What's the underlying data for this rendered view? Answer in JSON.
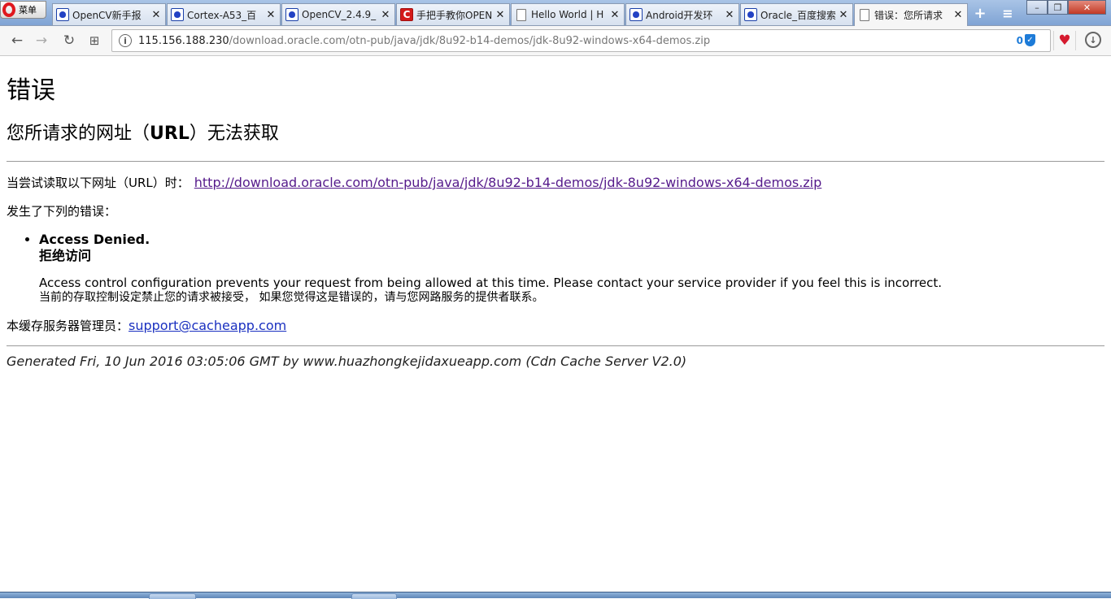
{
  "browser": {
    "menu_label": "菜单",
    "tabs": [
      {
        "title": "OpenCV新手报",
        "icon": "baidu-paw-icon"
      },
      {
        "title": "Cortex-A53_百",
        "icon": "baidu-paw-icon"
      },
      {
        "title": "OpenCV_2.4.9_",
        "icon": "baidu-paw-icon"
      },
      {
        "title": "手把手教你OPEN",
        "icon": "csdn-icon"
      },
      {
        "title": "Hello World | H",
        "icon": "document-icon"
      },
      {
        "title": "Android开发环",
        "icon": "baidu-paw-icon"
      },
      {
        "title": "Oracle_百度搜索",
        "icon": "baidu-paw-icon"
      },
      {
        "title": "错误：您所请求",
        "icon": "document-icon"
      }
    ],
    "close_glyph": "✕",
    "new_tab_glyph": "+",
    "tab_menu_glyph": "≡",
    "window_controls": {
      "minimize": "–",
      "maximize": "❐",
      "close": "✕"
    },
    "nav": {
      "back": "←",
      "forward": "→",
      "reload": "↻",
      "speed_dial": "⊞"
    },
    "url": {
      "host": "115.156.188.230",
      "path": "/download.oracle.com/otn-pub/java/jdk/8u92-b14-demos/jdk-8u92-windows-x64-demos.zip"
    },
    "adblock_count": "0",
    "colors": {
      "link_visited": "#551a8b",
      "link": "#1a30c0",
      "opera_red": "#e0181e"
    }
  },
  "page": {
    "title": "错误",
    "subtitle_pre": "您所请求的网址（",
    "subtitle_bold": "URL",
    "subtitle_post": "）无法获取",
    "attempt_label": "当尝试读取以下网址（URL）时：",
    "attempt_url": "http://download.oracle.com/otn-pub/java/jdk/8u92-b14-demos/jdk-8u92-windows-x64-demos.zip",
    "error_intro": "发生了下列的错误：",
    "error_title_en": "Access Denied.",
    "error_title_cn": "拒绝访问",
    "error_detail_en": "Access control configuration prevents your request from being allowed at this time. Please contact your service provider if you feel this is incorrect.",
    "error_detail_cn": "当前的存取控制设定禁止您的请求被接受， 如果您觉得这是错误的，请与您网路服务的提供者联系。",
    "admin_label": "本缓存服务器管理员：",
    "admin_email": "support@cacheapp.com",
    "generated": "Generated Fri, 10 Jun 2016 03:05:06 GMT by www.huazhongkejidaxueapp.com (Cdn Cache Server V2.0)"
  }
}
